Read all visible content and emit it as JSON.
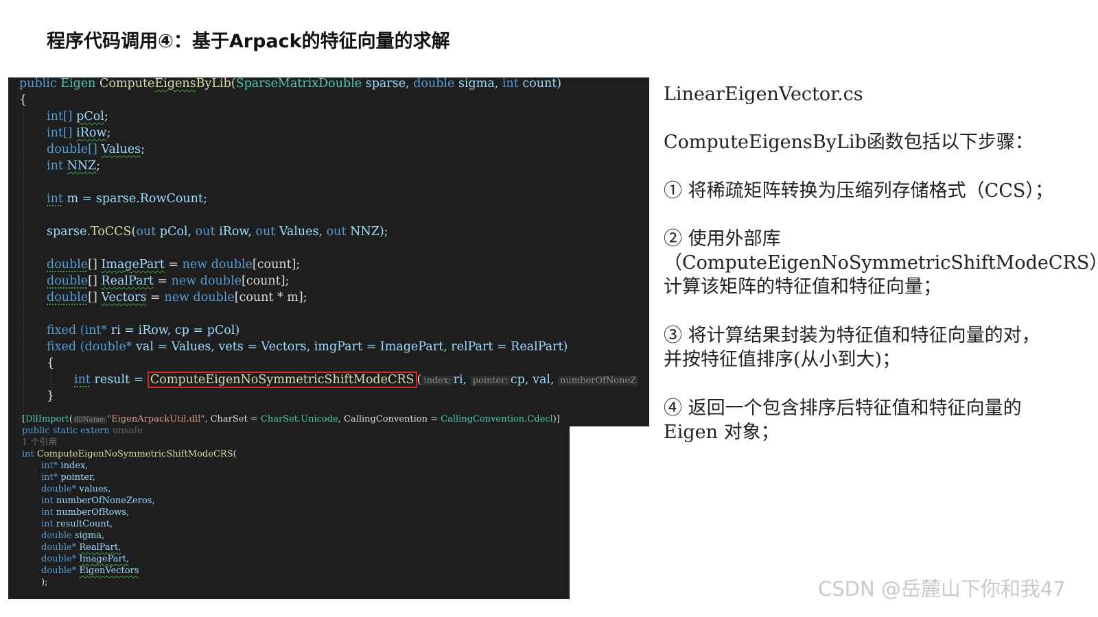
{
  "slide": {
    "title": "程序代码调用④：基于Arpack的特征向量的求解"
  },
  "code_top": {
    "l1_kw": "public",
    "l1_type": "Eigen",
    "l1_fn_a": "Compute",
    "l1_fn_b": "Eigens",
    "l1_fn_c": "ByLib",
    "l1_paren": "(",
    "l1_ptype": "SparseMatrixDouble",
    "l1_p1": "sparse,",
    "l1_kw2": "double",
    "l1_p2": "sigma,",
    "l1_kw3": "int",
    "l1_p3": "count)",
    "l2": "{",
    "l3_kw": "int[]",
    "l3_var": "pCol",
    "l3_end": ";",
    "l4_kw": "int[]",
    "l4_var": "iRow",
    "l4_end": ";",
    "l5_kw": "double[]",
    "l5_var": "Values",
    "l5_end": ";",
    "l6_kw": "int",
    "l6_var": "NNZ",
    "l6_end": ";",
    "l7_kw": "int",
    "l7_rest": "m = sparse.RowCount;",
    "l8_a": "sparse.",
    "l8_fn": "ToCCS",
    "l8_p": "(",
    "l8_out1": "out",
    "l8_v1": "pCol,",
    "l8_out2": "out",
    "l8_v2": "iRow,",
    "l8_out3": "out",
    "l8_v3": "Values,",
    "l8_out4": "out",
    "l8_v4": "NNZ);",
    "l9_kw": "double",
    "l9_br": "[]",
    "l9_var": "ImagePart",
    "l9_eq": "=",
    "l9_new": "new double",
    "l9_end": "[count];",
    "l10_kw": "double",
    "l10_br": "[]",
    "l10_var": "RealPart",
    "l10_eq": "=",
    "l10_new": "new double",
    "l10_end": "[count];",
    "l11_kw": "double",
    "l11_br": "[]",
    "l11_var": "Vectors",
    "l11_eq": "=",
    "l11_new": "new double",
    "l11_end": "[count * m];",
    "l12_kw": "fixed",
    "l12_kw2": "(int*",
    "l12_rest": "ri = iRow, cp = pCol)",
    "l13_kw": "fixed",
    "l13_kw2": "(double*",
    "l13_rest": "val = Values, vets = Vectors, imgPart = ImagePart, relPart = RealPart)",
    "l14": "{",
    "l15_kw": "int",
    "l15_var": "result =",
    "l15_fn": "ComputeEigenNoSymmetricShiftModeCRS",
    "l15_paren": "(",
    "l15_h1": "index:",
    "l15_a1": "ri,",
    "l15_h2": "pointer:",
    "l15_a2": "cp,",
    "l15_a3": "val,",
    "l15_h3": "numberOfNoneZ",
    "l16": "}"
  },
  "code_bottom": {
    "b1_a": "[",
    "b1_attr": "DllImport",
    "b1_p": "(",
    "b1_hint": "dllName:",
    "b1_str": "\"EigenArpackUtil.dll\"",
    "b1_b": ", CharSet =",
    "b1_c": "CharSet.Unicode",
    "b1_d": ", CallingConvention =",
    "b1_e": "CallingConvention.Cdecl",
    "b1_f": ")]",
    "b2_kw": "public static extern",
    "b2_kw2": "unsafe",
    "b3": "1 个引用",
    "b4_kw": "int",
    "b4_fn": "ComputeEigenNoSymmetricShiftModeCRS(",
    "params": [
      {
        "type": "int*",
        "name": "index,",
        "squiggle": false
      },
      {
        "type": "int*",
        "name": "pointer,",
        "squiggle": false
      },
      {
        "type": "double*",
        "name": "values,",
        "squiggle": false
      },
      {
        "type": "int",
        "name": "numberOfNoneZeros,",
        "squiggle": false
      },
      {
        "type": "int",
        "name": "numberOfRows,",
        "squiggle": false
      },
      {
        "type": "int",
        "name": "resultCount,",
        "squiggle": false
      },
      {
        "type": "double",
        "name": "sigma,",
        "squiggle": false
      },
      {
        "type": "double*",
        "name": "RealPart,",
        "squiggle": true
      },
      {
        "type": "double*",
        "name": "ImagePart,",
        "squiggle": true
      },
      {
        "type": "double*",
        "name": "EigenVectors",
        "squiggle": true
      }
    ],
    "b_end": ");"
  },
  "notes": {
    "file": "LinearEigenVector.cs",
    "intro": "ComputeEigensByLib函数包括以下步骤：",
    "s1": "① 将稀疏矩阵转换为压缩列存储格式（CCS）；",
    "s2_a": "② 使用外部库",
    "s2_b": "（ComputeEigenNoSymmetricShiftModeCRS）",
    "s2_c": "计算该矩阵的特征值和特征向量；",
    "s3_a": "③ 将计算结果封装为特征值和特征向量的对，",
    "s3_b": "并按特征值排序(从小到大)；",
    "s4_a": "④ 返回一个包含排序后特征值和特征向量的",
    "s4_b": " Eigen 对象；"
  },
  "watermark": "CSDN @岳麓山下你和我47"
}
